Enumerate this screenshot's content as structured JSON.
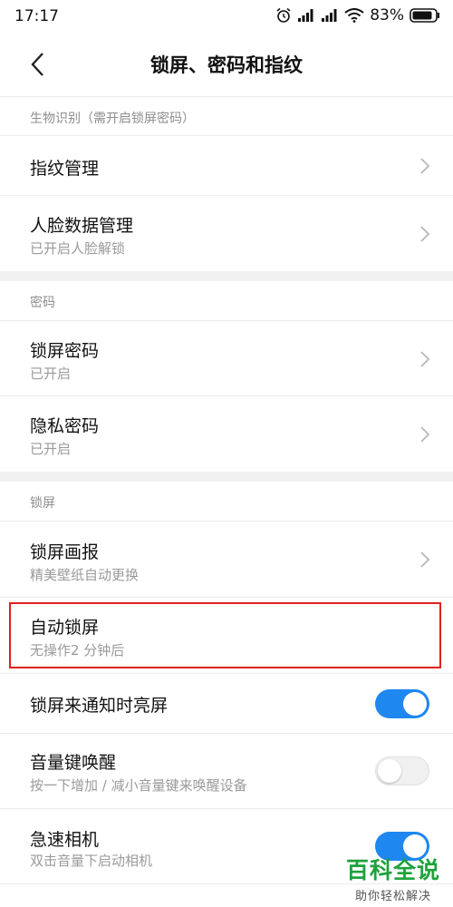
{
  "status_bar": {
    "time": "17:17",
    "battery": "83%"
  },
  "header": {
    "title": "锁屏、密码和指纹"
  },
  "sections": {
    "bio": {
      "label": "生物识别（需开启锁屏密码）",
      "fingerprint": {
        "title": "指纹管理"
      },
      "face": {
        "title": "人脸数据管理",
        "subtitle": "已开启人脸解锁"
      }
    },
    "password": {
      "label": "密码",
      "lock_password": {
        "title": "锁屏密码",
        "subtitle": "已开启"
      },
      "privacy_password": {
        "title": "隐私密码",
        "subtitle": "已开启"
      }
    },
    "lockscreen": {
      "label": "锁屏",
      "wallpaper": {
        "title": "锁屏画报",
        "subtitle": "精美壁纸自动更换"
      },
      "auto_lock": {
        "title": "自动锁屏",
        "subtitle": "无操作2 分钟后"
      },
      "notify_wake": {
        "title": "锁屏来通知时亮屏",
        "on": true
      },
      "volume_wake": {
        "title": "音量键唤醒",
        "subtitle": "按一下增加 / 减小音量键来唤醒设备",
        "on": false
      },
      "quick_camera": {
        "title": "急速相机",
        "subtitle": "双击音量下启动相机",
        "on": true
      }
    }
  },
  "watermark": {
    "brand": "百科全说",
    "slogan": "助你轻松解决"
  },
  "colors": {
    "accent": "#1e87f0",
    "highlight": "#e02020",
    "watermark": "#1ea23c"
  }
}
